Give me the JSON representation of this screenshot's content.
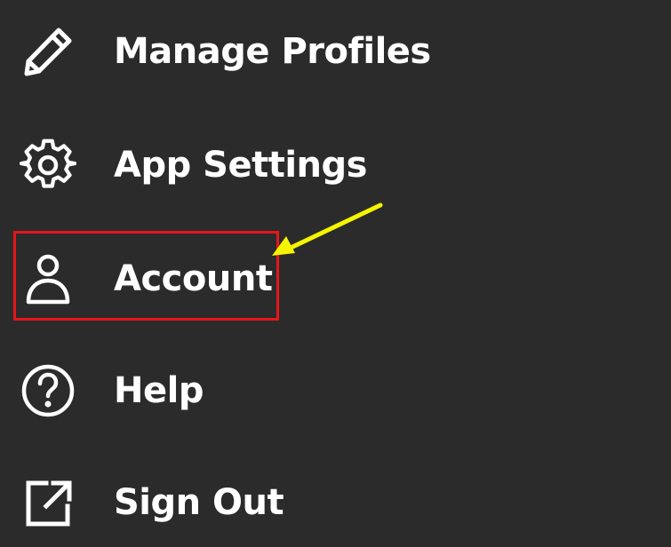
{
  "menu": {
    "items": [
      {
        "label": "Manage Profiles",
        "icon": "pencil-icon"
      },
      {
        "label": "App Settings",
        "icon": "gear-icon"
      },
      {
        "label": "Account",
        "icon": "person-icon"
      },
      {
        "label": "Help",
        "icon": "help-circle-icon"
      },
      {
        "label": "Sign Out",
        "icon": "external-link-icon"
      }
    ]
  },
  "annotation": {
    "highlight_color": "#e8141b",
    "arrow_color": "#f5f500",
    "target": "Account"
  },
  "colors": {
    "background": "#2b2b2b",
    "text": "#ffffff"
  }
}
